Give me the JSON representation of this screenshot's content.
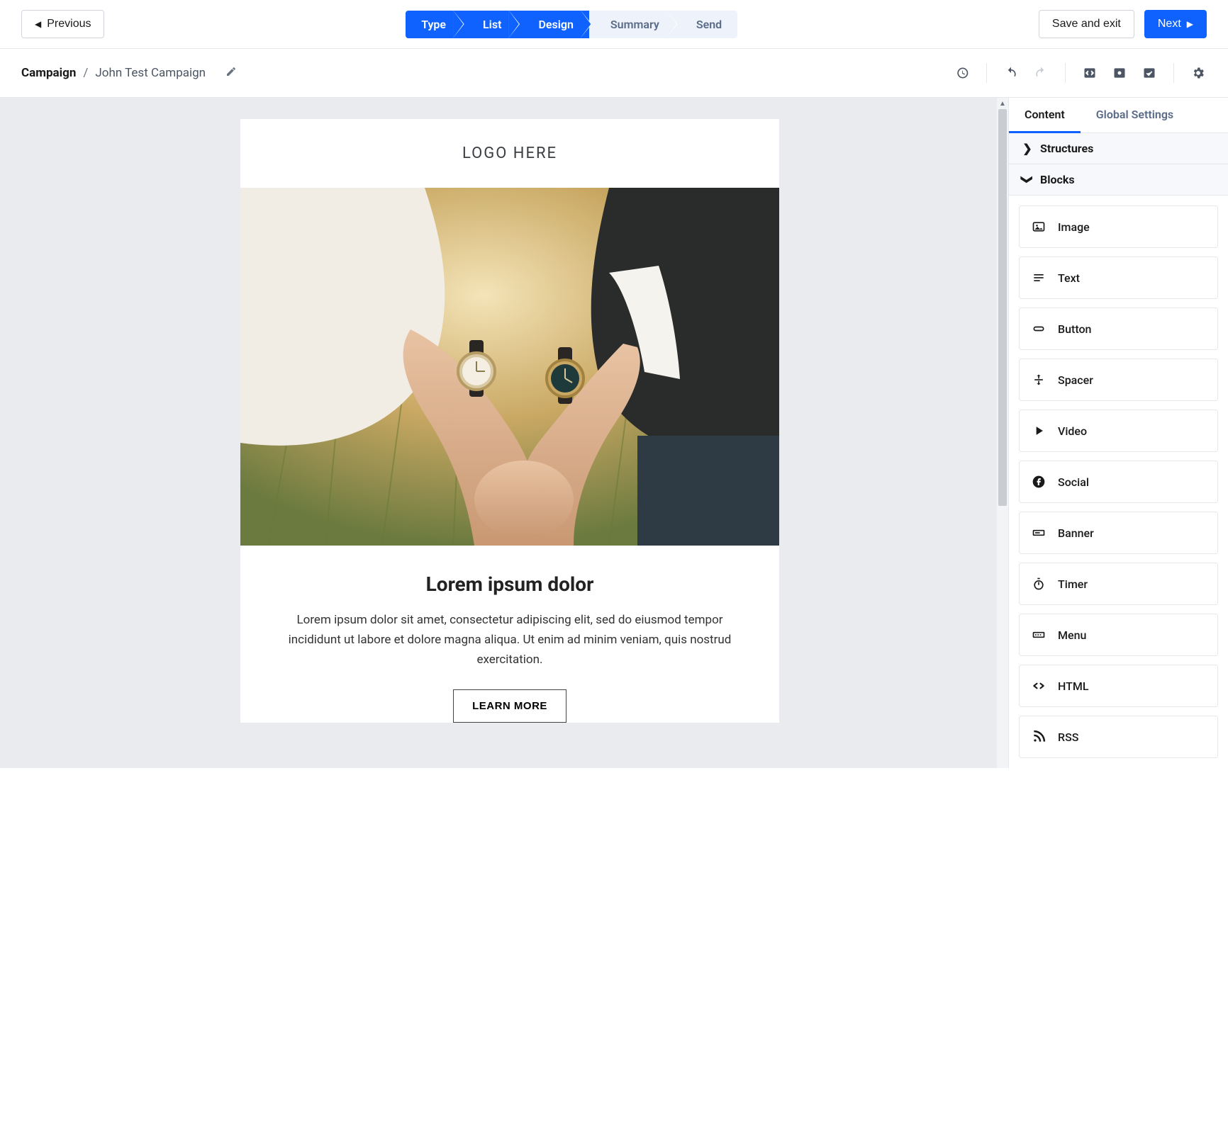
{
  "topbar": {
    "previous": "Previous",
    "save_exit": "Save and exit",
    "next": "Next"
  },
  "steps": [
    "Type",
    "List",
    "Design",
    "Summary",
    "Send"
  ],
  "active_step_index": 2,
  "breadcrumb": {
    "root": "Campaign",
    "leaf": "John Test Campaign"
  },
  "panel": {
    "tabs": [
      "Content",
      "Global Settings"
    ],
    "active_tab_index": 0,
    "sections": {
      "structures": "Structures",
      "blocks": "Blocks"
    },
    "blocks": [
      {
        "icon": "image",
        "label": "Image"
      },
      {
        "icon": "text",
        "label": "Text"
      },
      {
        "icon": "button",
        "label": "Button"
      },
      {
        "icon": "spacer",
        "label": "Spacer"
      },
      {
        "icon": "video",
        "label": "Video"
      },
      {
        "icon": "social",
        "label": "Social"
      },
      {
        "icon": "banner",
        "label": "Banner"
      },
      {
        "icon": "timer",
        "label": "Timer"
      },
      {
        "icon": "menu",
        "label": "Menu"
      },
      {
        "icon": "html",
        "label": "HTML"
      },
      {
        "icon": "rss",
        "label": "RSS"
      }
    ]
  },
  "email": {
    "logo_text": "LOGO HERE",
    "headline": "Lorem ipsum dolor",
    "body": "Lorem ipsum dolor sit amet, consectetur adipiscing elit, sed do eiusmod tempor incididunt ut labore et dolore magna aliqua. Ut enim ad minim veniam, quis nostrud exercitation.",
    "cta": "LEARN MORE"
  }
}
